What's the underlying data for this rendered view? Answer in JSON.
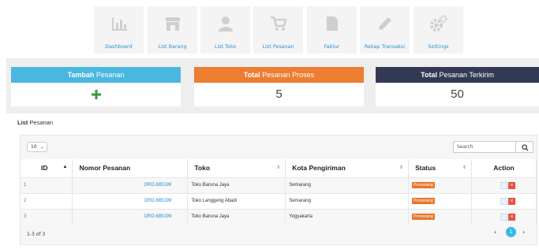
{
  "nav": {
    "items": [
      {
        "label": "Dashboard",
        "icon": "chart-icon"
      },
      {
        "label": "List Barang",
        "icon": "store-icon"
      },
      {
        "label": "List Toko",
        "icon": "user-icon"
      },
      {
        "label": "List Pesanan",
        "icon": "cart-icon"
      },
      {
        "label": "Faktur",
        "icon": "document-icon"
      },
      {
        "label": "Rekap Transaksi",
        "icon": "pencil-icon"
      },
      {
        "label": "Settings",
        "icon": "gears-icon"
      }
    ]
  },
  "cards": {
    "add": {
      "bold": "Tambah",
      "rest": " Pesanan",
      "color": "#4ab7e0"
    },
    "process": {
      "bold": "Total",
      "rest": " Pesanan Proses",
      "value": "5",
      "color": "#ec7d31"
    },
    "sent": {
      "bold": "Total",
      "rest": " Pesanan Terkirim",
      "value": "50",
      "color": "#323a53"
    }
  },
  "panel": {
    "title_bold": "List",
    "title_rest": " Pesanan"
  },
  "table": {
    "per_page": "10",
    "search_placeholder": "Search",
    "columns": [
      "ID",
      "Nomor Pesanan",
      "Toko",
      "Kota Pengiriman",
      "Status",
      "Action"
    ],
    "rows": [
      {
        "id": "1",
        "order": "ORD.685199",
        "toko": "Toko Baruna Jaya",
        "kota": "Semarang",
        "status": "Processing"
      },
      {
        "id": "2",
        "order": "ORD.685199",
        "toko": "Toko Langgeng Abadi",
        "kota": "Semarang",
        "status": "Processing"
      },
      {
        "id": "3",
        "order": "ORD.685199",
        "toko": "Toko Baruna Jaya",
        "kota": "Yogyakarta",
        "status": "Processing"
      }
    ],
    "footer_count": "1-3 of 3",
    "current_page": "1"
  }
}
